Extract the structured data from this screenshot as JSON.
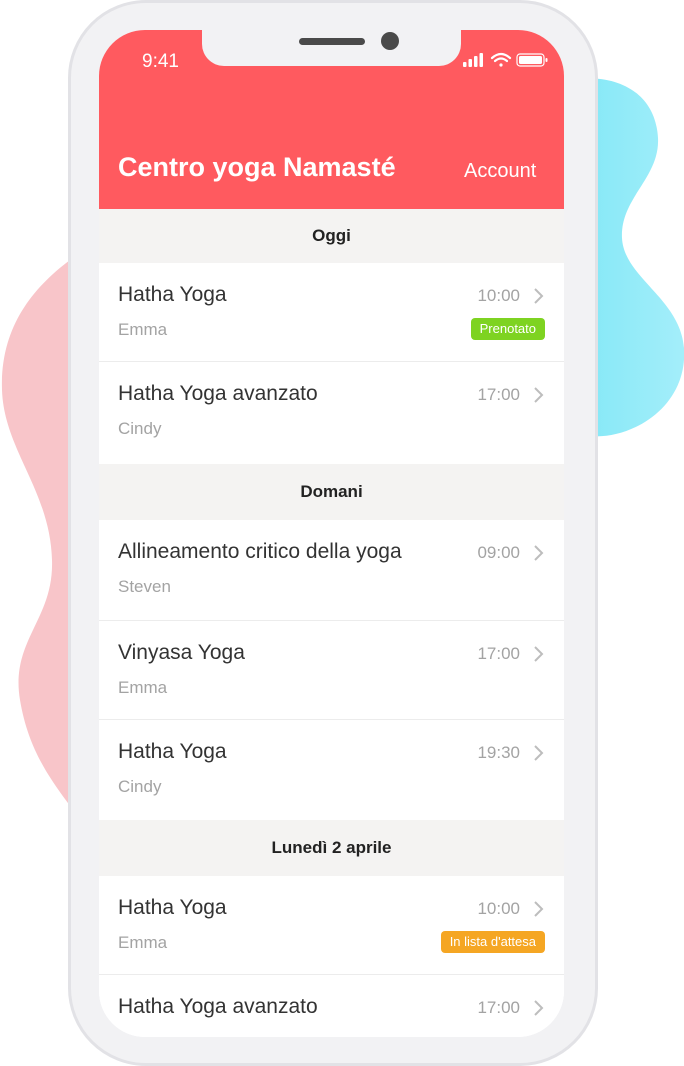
{
  "status_bar": {
    "time": "9:41"
  },
  "header": {
    "title": "Centro yoga Namasté",
    "account_label": "Account"
  },
  "colors": {
    "header": "#ff5a5f",
    "booked": "#7ed321",
    "waitlist": "#f5a623"
  },
  "sections": [
    {
      "title": "Oggi",
      "items": [
        {
          "name": "Hatha Yoga",
          "teacher": "Emma",
          "time": "10:00",
          "badge": "Prenotato"
        },
        {
          "name": "Hatha Yoga avanzato",
          "teacher": "Cindy",
          "time": "17:00"
        }
      ]
    },
    {
      "title": "Domani",
      "items": [
        {
          "name": "Allineamento critico della yoga",
          "teacher": "Steven",
          "time": "09:00"
        },
        {
          "name": "Vinyasa Yoga",
          "teacher": "Emma",
          "time": "17:00"
        },
        {
          "name": "Hatha Yoga",
          "teacher": "Cindy",
          "time": "19:30"
        }
      ]
    },
    {
      "title": "Lunedì 2 aprile",
      "items": [
        {
          "name": "Hatha Yoga",
          "teacher": "Emma",
          "time": "10:00",
          "badge": "In lista d'attesa"
        },
        {
          "name": "Hatha Yoga avanzato",
          "teacher": "",
          "time": "17:00"
        }
      ]
    }
  ]
}
